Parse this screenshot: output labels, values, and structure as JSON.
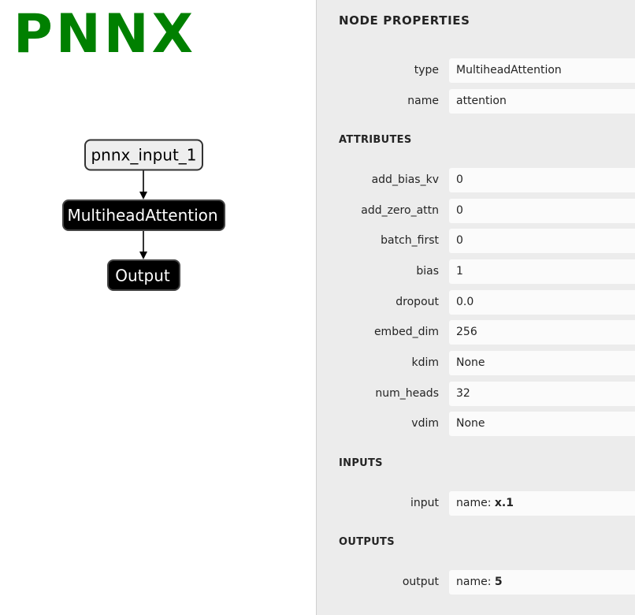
{
  "app": {
    "logo": "PNNX",
    "brand_color": "#008000"
  },
  "graph": {
    "nodes": [
      {
        "id": "input",
        "label": "pnnx_input_1",
        "style": "light"
      },
      {
        "id": "mha",
        "label": "MultiheadAttention",
        "style": "dark"
      },
      {
        "id": "output",
        "label": "Output",
        "style": "dark"
      }
    ],
    "edges": [
      {
        "from": "pnnx_input_1",
        "to": "MultiheadAttention"
      },
      {
        "from": "MultiheadAttention",
        "to": "Output"
      }
    ]
  },
  "sidebar": {
    "title": "NODE PROPERTIES",
    "properties": {
      "type": {
        "name": "type",
        "value": "MultiheadAttention"
      },
      "name": {
        "name": "name",
        "value": "attention"
      }
    },
    "attributes": {
      "title": "ATTRIBUTES",
      "items": [
        {
          "name": "add_bias_kv",
          "value": "0"
        },
        {
          "name": "add_zero_attn",
          "value": "0"
        },
        {
          "name": "batch_first",
          "value": "0"
        },
        {
          "name": "bias",
          "value": "1"
        },
        {
          "name": "dropout",
          "value": "0.0"
        },
        {
          "name": "embed_dim",
          "value": "256"
        },
        {
          "name": "kdim",
          "value": "None"
        },
        {
          "name": "num_heads",
          "value": "32"
        },
        {
          "name": "vdim",
          "value": "None"
        }
      ]
    },
    "inputs": {
      "title": "INPUTS",
      "items": [
        {
          "name": "input",
          "value_prefix": "name: ",
          "value": "x.1"
        }
      ]
    },
    "outputs": {
      "title": "OUTPUTS",
      "items": [
        {
          "name": "output",
          "value_prefix": "name: ",
          "value": "5"
        }
      ]
    }
  }
}
